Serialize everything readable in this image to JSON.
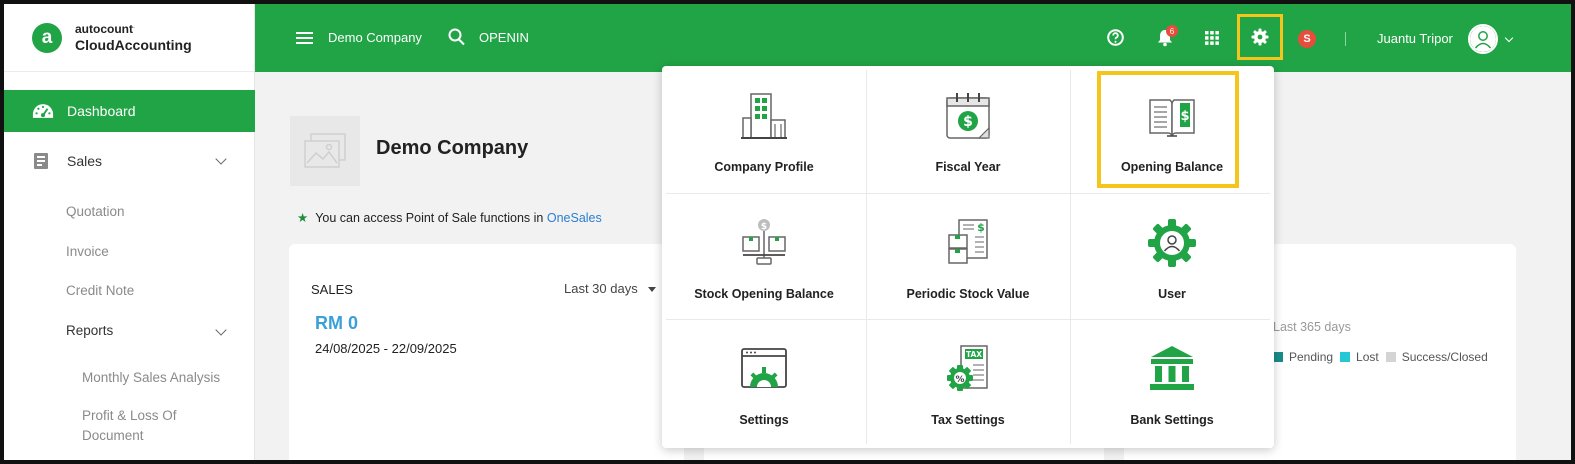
{
  "brand": {
    "top": "autocount",
    "bottom": "CloudAccounting"
  },
  "sidebar": {
    "dashboard": "Dashboard",
    "sales": "Sales",
    "items": [
      "Quotation",
      "Invoice",
      "Credit Note"
    ],
    "reports": "Reports",
    "report_items": [
      "Monthly Sales Analysis",
      "Profit & Loss Of Document"
    ]
  },
  "header": {
    "company": "Demo Company",
    "search_query": "OPENIN",
    "notification_count": "6",
    "user_initial": "S",
    "user_name": "Juantu Tripor"
  },
  "main": {
    "company_title": "Demo Company",
    "notice_text": "You can access Point of Sale functions in",
    "notice_link": "OneSales",
    "sales_card": {
      "title": "SALES",
      "range": "Last 30 days",
      "amount": "RM 0",
      "dates": "24/08/2025 - 22/09/2025"
    },
    "right_card": {
      "range": "Last 365 days",
      "legend": [
        {
          "label": "Pending",
          "color": "#1a8c8a"
        },
        {
          "label": "Lost",
          "color": "#25c7d4"
        },
        {
          "label": "Success/Closed",
          "color": "#d4d4d4"
        }
      ]
    }
  },
  "settings_menu": {
    "items": [
      {
        "label": "Company Profile",
        "icon": "building-icon"
      },
      {
        "label": "Fiscal Year",
        "icon": "calendar-dollar-icon"
      },
      {
        "label": "Opening Balance",
        "icon": "ledger-book-icon",
        "highlighted": true
      },
      {
        "label": "Stock Opening Balance",
        "icon": "stock-scale-icon"
      },
      {
        "label": "Periodic Stock Value",
        "icon": "stock-value-icon"
      },
      {
        "label": "User",
        "icon": "user-gear-icon"
      },
      {
        "label": "Settings",
        "icon": "settings-window-icon"
      },
      {
        "label": "Tax Settings",
        "icon": "tax-icon"
      },
      {
        "label": "Bank Settings",
        "icon": "bank-icon"
      }
    ]
  },
  "colors": {
    "brand_green": "#21a446",
    "highlight": "#f5c51b",
    "link": "#2a7fd0",
    "amount": "#3aa0d9"
  }
}
